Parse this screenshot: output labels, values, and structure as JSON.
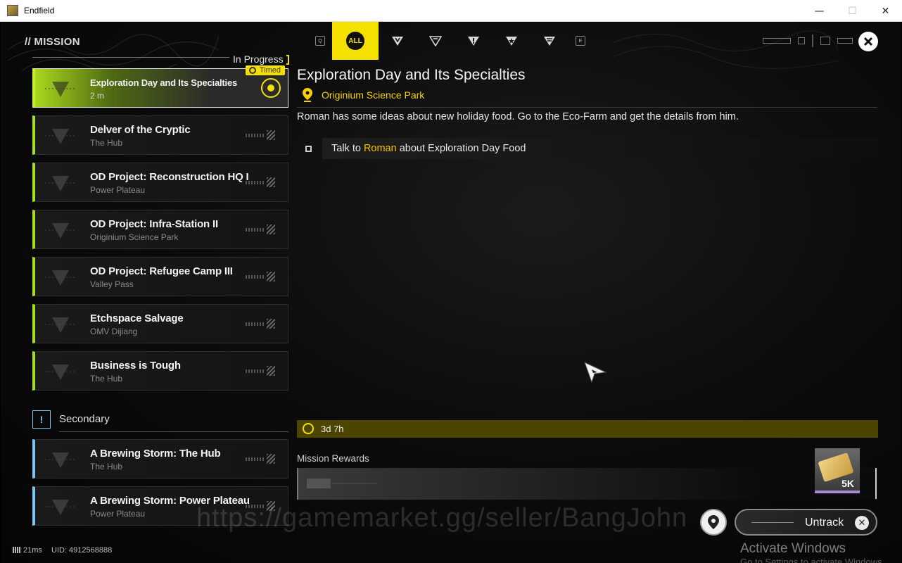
{
  "window": {
    "title": "Endfield",
    "minimize": "—",
    "maximize": "☐",
    "close": "✕"
  },
  "header": {
    "title": "// MISSION",
    "filters": [
      {
        "key": "Q"
      },
      {
        "label": "ALL",
        "active": true
      },
      {
        "icon": "main-mission-icon"
      },
      {
        "icon": "side-mission-icon"
      },
      {
        "icon": "alert-mission-icon"
      },
      {
        "icon": "event-mission-icon"
      },
      {
        "icon": "daily-mission-icon"
      },
      {
        "key": "E"
      }
    ],
    "close_icon": "close-icon"
  },
  "sections": {
    "in_progress": "In Progress",
    "secondary": "Secondary",
    "secondary_icon": "!"
  },
  "missions": [
    {
      "name": "Exploration Day and Its Specialties",
      "sub": "2 m",
      "selected": true,
      "badge": "Timed",
      "tracked": true
    },
    {
      "name": "Delver of the Cryptic",
      "sub": "The Hub"
    },
    {
      "name": "OD Project: Reconstruction HQ I",
      "sub": "Power Plateau"
    },
    {
      "name": "OD Project: Infra-Station II",
      "sub": "Originium Science Park"
    },
    {
      "name": "OD Project: Refugee Camp III",
      "sub": "Valley Pass"
    },
    {
      "name": "Etchspace Salvage",
      "sub": "OMV Dijiang"
    },
    {
      "name": "Business is Tough",
      "sub": "The Hub"
    }
  ],
  "secondary_missions": [
    {
      "name": "A Brewing Storm: The Hub",
      "sub": "The Hub"
    },
    {
      "name": "A Brewing Storm: Power Plateau",
      "sub": "Power Plateau"
    }
  ],
  "detail": {
    "title": "Exploration Day and Its Specialties",
    "location": "Originium Science Park",
    "description": "Roman has some ideas about new holiday food. Go to the Eco-Farm and get the details from him.",
    "objective": {
      "prefix": "Talk to ",
      "highlight": "Roman",
      "suffix": " about Exploration Day Food"
    },
    "timer": "3d 7h",
    "rewards_label": "Mission Rewards",
    "reward_qty": "5K"
  },
  "actions": {
    "untrack": "Untrack",
    "untrack_x": "✕"
  },
  "footer": {
    "ping": "21ms",
    "uid": "UID: 4912568888"
  },
  "overlay": {
    "watermark": "https://gamemarket.gg/seller/BangJohn",
    "activate": "Activate Windows",
    "activate_sub": "Go to Settings to activate Windows."
  },
  "colors": {
    "accent": "#f5e100",
    "main_bar": "#a6dd20",
    "secondary_bar": "#7cc4f0",
    "location": "#f5d200"
  }
}
